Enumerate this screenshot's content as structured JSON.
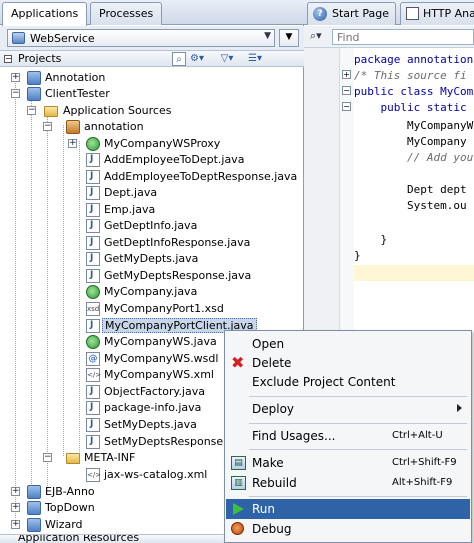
{
  "left_panel": {
    "tabs": [
      {
        "label": "Applications"
      },
      {
        "label": "Processes"
      }
    ],
    "application_selector": {
      "value": "WebService"
    },
    "projects_header": {
      "title": "Projects"
    },
    "tree": [
      {
        "label": "Annotation"
      },
      {
        "label": "ClientTester"
      },
      {
        "label": "Application Sources"
      },
      {
        "label": "annotation"
      },
      {
        "label": "MyCompanyWSProxy"
      },
      {
        "label": "AddEmployeeToDept.java"
      },
      {
        "label": "AddEmployeeToDeptResponse.java"
      },
      {
        "label": "Dept.java"
      },
      {
        "label": "Emp.java"
      },
      {
        "label": "GetDeptInfo.java"
      },
      {
        "label": "GetDeptInfoResponse.java"
      },
      {
        "label": "GetMyDepts.java"
      },
      {
        "label": "GetMyDeptsResponse.java"
      },
      {
        "label": "MyCompany.java"
      },
      {
        "label": "MyCompanyPort1.xsd"
      },
      {
        "label": "MyCompanyPortClient.java"
      },
      {
        "label": "MyCompanyWS.java"
      },
      {
        "label": "MyCompanyWS.wsdl"
      },
      {
        "label": "MyCompanyWS.xml"
      },
      {
        "label": "ObjectFactory.java"
      },
      {
        "label": "package-info.java"
      },
      {
        "label": "SetMyDepts.java"
      },
      {
        "label": "SetMyDeptsResponse.java"
      },
      {
        "label": "META-INF"
      },
      {
        "label": "jax-ws-catalog.xml"
      },
      {
        "label": "EJB-Anno"
      },
      {
        "label": "TopDown"
      },
      {
        "label": "Wizard"
      },
      {
        "label": "Application Resources"
      }
    ]
  },
  "editor": {
    "tabs": [
      {
        "label": "Start Page",
        "icon": "globe-icon"
      },
      {
        "label": "HTTP Analy"
      }
    ],
    "find": {
      "placeholder": "Find"
    },
    "code_lines": [
      "package annotation",
      "/* This source fi",
      "public class MyCom",
      "    public static",
      "        MyCompanyW",
      "        MyCompany ",
      "        // Add you",
      "",
      "        Dept dept ",
      "        System.ou",
      "",
      "    }",
      "}"
    ]
  },
  "context_menu": {
    "items": [
      {
        "label": "Open",
        "shortcut": "",
        "icon": ""
      },
      {
        "label": "Delete",
        "shortcut": "",
        "icon": "red-x-icon"
      },
      {
        "label": "Exclude Project Content",
        "shortcut": "",
        "icon": ""
      },
      {
        "label": "Deploy",
        "shortcut": "",
        "icon": "",
        "submenu": true
      },
      {
        "label": "Find Usages...",
        "shortcut": "Ctrl+Alt-U",
        "icon": ""
      },
      {
        "label": "Make",
        "shortcut": "Ctrl+Shift-F9",
        "icon": "make-icon"
      },
      {
        "label": "Rebuild",
        "shortcut": "Alt+Shift-F9",
        "icon": "rebuild-icon"
      },
      {
        "label": "Run",
        "shortcut": "",
        "icon": "run-icon",
        "highlighted": true
      },
      {
        "label": "Debug",
        "shortcut": "",
        "icon": "debug-icon"
      }
    ]
  },
  "colors": {
    "menu_highlight": "#2f63a8",
    "selection": "#c9d6ea",
    "keyword": "#0000a8",
    "current_line": "#fff6d6"
  }
}
